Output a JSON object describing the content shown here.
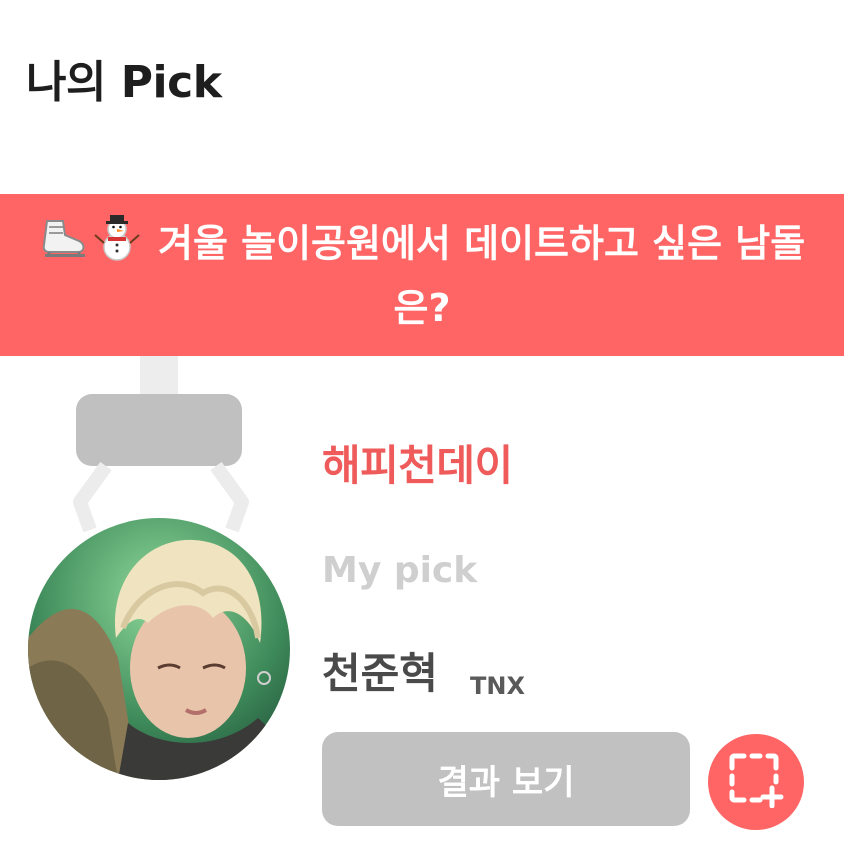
{
  "header": {
    "title": "나의 Pick"
  },
  "question": {
    "emojis": [
      "ice-skate-icon",
      "snowman-icon"
    ],
    "text": "겨울 놀이공원에서 데이트하고 싶은 남돌은?"
  },
  "event": {
    "name": "해피천데이"
  },
  "pick": {
    "label": "My pick",
    "name": "천준혁",
    "group": "TNX"
  },
  "actions": {
    "result_label": "결과 보기",
    "capture_icon": "screenshot-capture-icon"
  },
  "colors": {
    "accent": "#ff6565",
    "event_text": "#ef5a5a",
    "button_gray": "#c1c1c1"
  }
}
